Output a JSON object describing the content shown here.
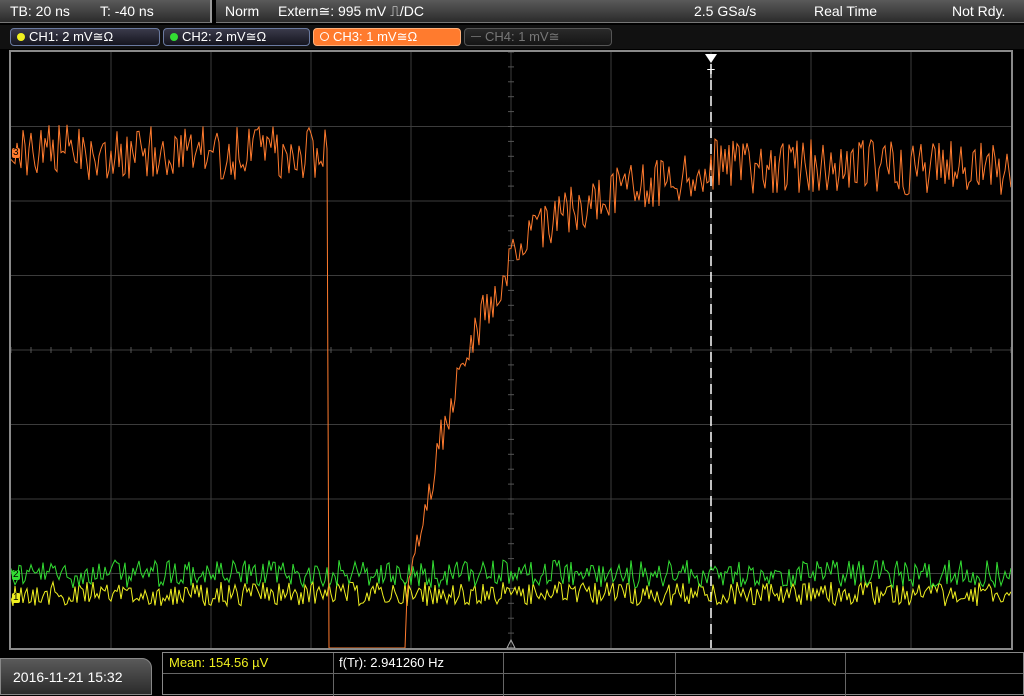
{
  "topbar": {
    "timebase": "TB: 20 ns",
    "trigger_offset": "T: -40 ns",
    "trigger_mode": "Norm",
    "trigger_source": "Extern≅: 995 mV ⎍/DC",
    "sample_rate": "2.5 GSa/s",
    "acq_mode": "Real Time",
    "status": "Not Rdy."
  },
  "channels": [
    {
      "label": "CH1: 2 mV≅Ω",
      "color": "#f0f020",
      "state": "on"
    },
    {
      "label": "CH2: 2 mV≅Ω",
      "color": "#33dd33",
      "state": "on"
    },
    {
      "label": "CH3: 1 mV≅Ω",
      "color": "#ff7b2e",
      "state": "active"
    },
    {
      "label": "CH4: 1 mV≅",
      "color": "#777777",
      "state": "off"
    }
  ],
  "markers": {
    "trigger": "T",
    "ch3": "3",
    "ch2": "2",
    "ch1": "1"
  },
  "bottombar": {
    "datetime": "2016-11-21 15:32",
    "meas1": "Mean: 154.56 µV",
    "meas2": "f(Tr): 2.941260 Hz"
  },
  "colors": {
    "ch1": "#f0f020",
    "ch2": "#33dd33",
    "ch3": "#ff7b2e",
    "grid": "#4a4a4a",
    "trigger_line": "#ffffff",
    "meas_label": "#f0f020"
  }
}
